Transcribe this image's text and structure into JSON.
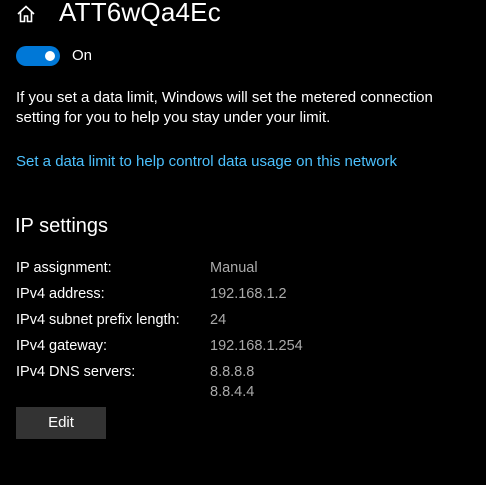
{
  "header": {
    "title": "ATT6wQa4Ec",
    "home_icon": "home-icon"
  },
  "metered": {
    "toggle_state": "On",
    "toggle_color": "#0078d7",
    "description": "If you set a data limit, Windows will set the metered connection setting for you to help you stay under your limit.",
    "link_text": "Set a data limit to help control data usage on this network",
    "link_color": "#4cc2ff"
  },
  "ip_settings": {
    "title": "IP settings",
    "rows": [
      {
        "label": "IP assignment:",
        "values": [
          "Manual"
        ]
      },
      {
        "label": "IPv4 address:",
        "values": [
          "192.168.1.2"
        ]
      },
      {
        "label": "IPv4 subnet prefix length:",
        "values": [
          "24"
        ]
      },
      {
        "label": "IPv4 gateway:",
        "values": [
          "192.168.1.254"
        ]
      },
      {
        "label": "IPv4 DNS servers:",
        "values": [
          "8.8.8.8",
          "8.8.4.4"
        ]
      }
    ],
    "edit_label": "Edit"
  }
}
